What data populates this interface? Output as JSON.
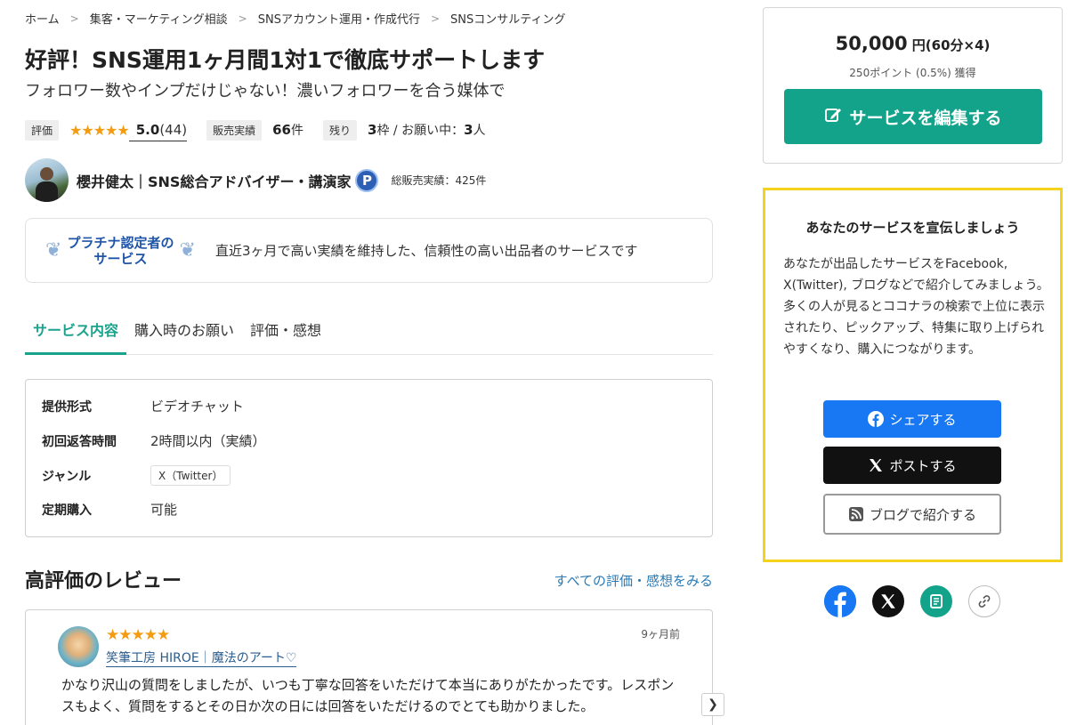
{
  "breadcrumb": [
    "ホーム",
    "集客・マーケティング相談",
    "SNSアカウント運用・作成代行",
    "SNSコンサルティング"
  ],
  "title": "好評！SNS運用1ヶ月間1対1で徹底サポートします",
  "subtitle": "フォロワー数やインプだけじゃない！濃いフォロワーを合う媒体で",
  "stats": {
    "rating_tag": "評価",
    "stars": "★★★★★",
    "rating": "5.0",
    "rating_count": "(44)",
    "sales_tag": "販売実績",
    "sales_value": "66",
    "sales_unit": "件",
    "remaining_tag": "残り",
    "remaining_value": "3",
    "remaining_unit": "枠 / お願い中：",
    "requesting_value": "3",
    "requesting_unit": "人"
  },
  "seller": {
    "name": "櫻井健太｜SNS総合アドバイザー・講演家",
    "badge": "P",
    "total_sales": "総販売実績：425件"
  },
  "platinum": {
    "badge_line1": "プラチナ認定者の",
    "badge_line2": "サービス",
    "description": "直近3ヶ月で高い実績を維持した、信頼性の高い出品者のサービスです"
  },
  "tabs": [
    "サービス内容",
    "購入時のお願い",
    "評価・感想"
  ],
  "info": [
    {
      "key": "提供形式",
      "value": "ビデオチャット"
    },
    {
      "key": "初回返答時間",
      "value": "2時間以内（実績）"
    },
    {
      "key": "ジャンル",
      "value": "X（Twitter）"
    },
    {
      "key": "定期購入",
      "value": "可能"
    }
  ],
  "reviews": {
    "heading": "高評価のレビュー",
    "see_all": "すべての評価・感想をみる",
    "item": {
      "stars": "★★★★★",
      "name": "笑筆工房 HIROE｜魔法のアート♡",
      "date": "9ヶ月前",
      "text": "かなり沢山の質問をしましたが、いつも丁寧な回答をいただけて本当にありがたかったです。レスポンスもよく、質問をするとその日か次の日には回答をいただけるのでとても助かりました。"
    }
  },
  "price": {
    "amount": "50,000",
    "unit": "円",
    "detail": "(60分×4)",
    "points": "250ポイント (0.5%) 獲得",
    "edit_button": "サービスを編集する"
  },
  "promo": {
    "title": "あなたのサービスを宣伝しましょう",
    "text_1": "あなたが出品したサービスをFacebook, X(Twitter), ブログなどで紹介してみましょう。",
    "text_2": "多くの人が見るとココナラの検索で上位に表示されたり、ピックアップ、特集に取り上げられやすくなり、購入につながります。",
    "facebook_button": "シェアする",
    "x_button": "ポストする",
    "blog_button": "ブログで紹介する"
  },
  "colors": {
    "accent": "#13a38a",
    "facebook": "#1877f2",
    "x": "#111111",
    "highlight_border": "#f5d21b",
    "star": "#f39c12"
  }
}
